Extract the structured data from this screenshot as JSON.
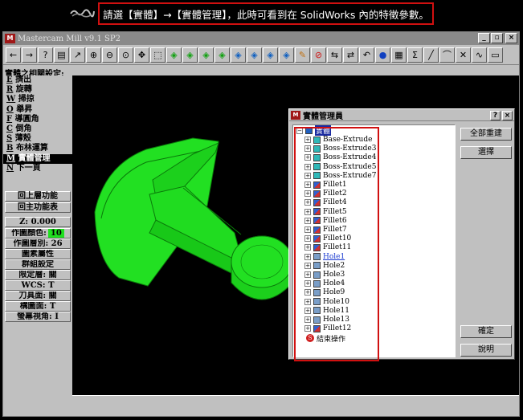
{
  "banner": {
    "text": "請選【實體】→【實體管理】，此時可看到在 SolidWorks 內的特徵參數。"
  },
  "app": {
    "title": "Mastercam Mill v9.1 SP2",
    "icon_text": "M",
    "window_buttons": [
      "_",
      "▫",
      "×"
    ]
  },
  "menu": {
    "header": "實體之相關設定:",
    "items": [
      {
        "key": "E",
        "label": "擠出"
      },
      {
        "key": "R",
        "label": "旋轉"
      },
      {
        "key": "W",
        "label": "掃掠"
      },
      {
        "key": "O",
        "label": "舉昇"
      },
      {
        "key": "F",
        "label": "導圓角"
      },
      {
        "key": "C",
        "label": "倒角"
      },
      {
        "key": "S",
        "label": "薄殼"
      },
      {
        "key": "B",
        "label": "布林運算"
      },
      {
        "key": "M",
        "label": "實體管理"
      },
      {
        "key": "N",
        "label": "下一頁"
      }
    ],
    "buttons": [
      "回上層功能",
      "回主功能表"
    ],
    "z_label": "Z:  0.000",
    "color_label": "作圖顏色:",
    "color_value": "10",
    "status": [
      "作圖層別: 26",
      "圖素屬性",
      "群組設定",
      "限定層: 關",
      "WCS:  T",
      "刀具面: 關",
      "構圖面:  T",
      "螢幕視角:  I"
    ]
  },
  "dialog": {
    "title": "實體管理員",
    "help_btn": "?",
    "close_btn": "×",
    "root": "實體",
    "features": [
      "Base-Extrude",
      "Boss-Extrude3",
      "Boss-Extrude4",
      "Boss-Extrude5",
      "Boss-Extrude7",
      "Fillet1",
      "Fillet2",
      "Fillet4",
      "Fillet5",
      "Fillet6",
      "Fillet7",
      "Fillet10",
      "Fillet11",
      "Hole1",
      "Hole2",
      "Hole3",
      "Hole4",
      "Hole9",
      "Hole10",
      "Hole11",
      "Hole13",
      "Fillet12"
    ],
    "end_op": "結束操作",
    "buttons": {
      "rebuild": "全部重建",
      "select": "選擇",
      "ok": "確定",
      "help": "說明"
    }
  },
  "colors": {
    "accent_red": "#d01010",
    "model_green": "#20e020",
    "selection_blue": "#1a2aa0"
  }
}
